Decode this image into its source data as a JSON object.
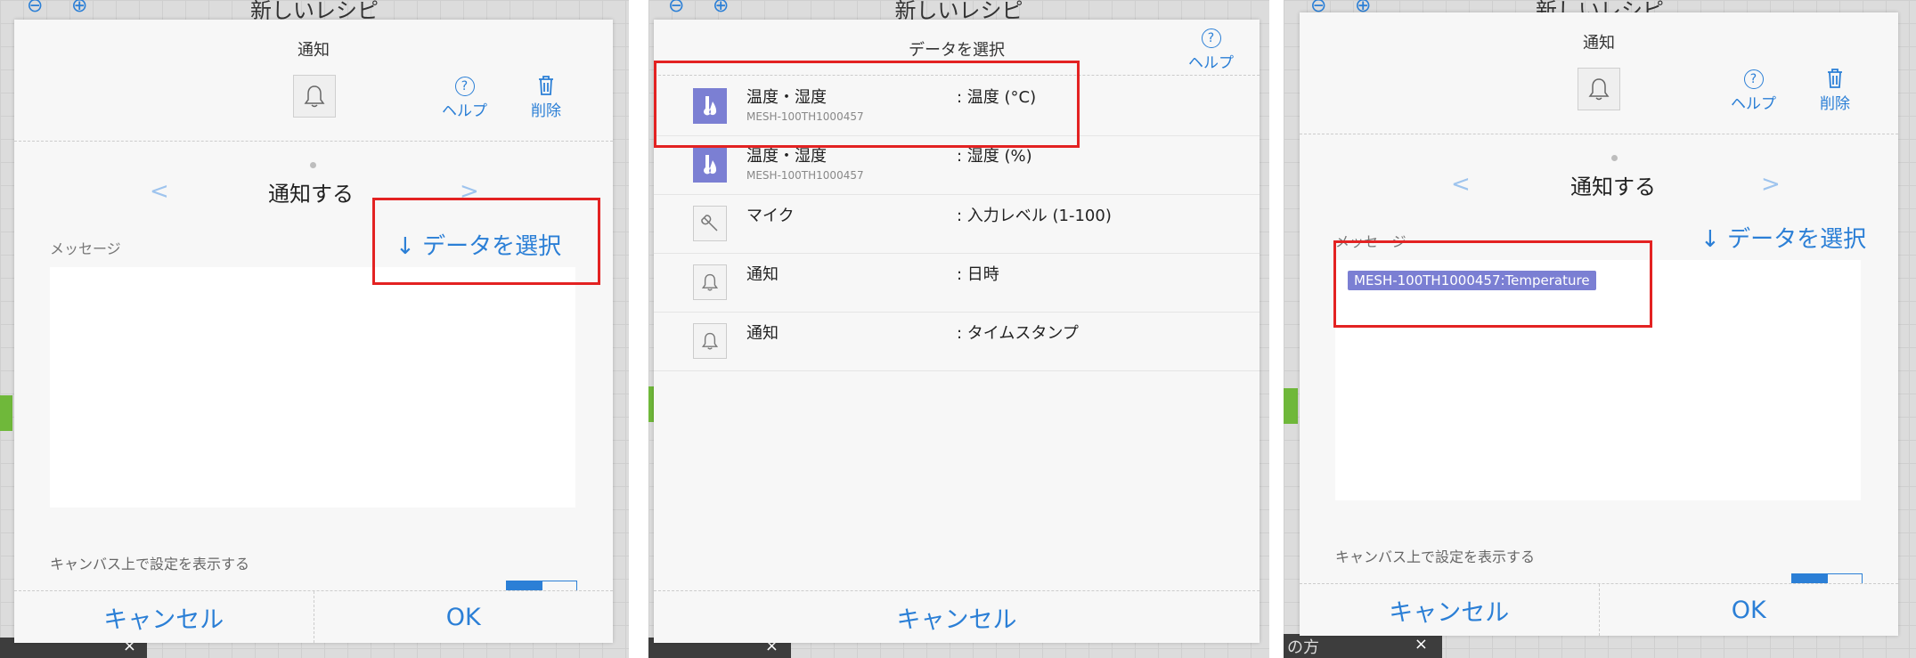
{
  "app": {
    "title": "新しいレシピ"
  },
  "panel1": {
    "dialog_title": "通知",
    "help_label": "ヘルプ",
    "delete_label": "削除",
    "notify_title": "通知する",
    "message_label": "メッセージ",
    "select_data_label": "データを選択",
    "show_on_canvas_label": "キャンバス上で設定を表示する",
    "cancel_label": "キャンセル",
    "ok_label": "OK"
  },
  "panel2": {
    "dialog_title": "データを選択",
    "help_label": "ヘルプ",
    "cancel_label": "キャンセル",
    "items": [
      {
        "name": "温度・湿度",
        "sub": "MESH-100TH1000457",
        "value": ": 温度 (°C)",
        "icon": "thermometer-icon"
      },
      {
        "name": "温度・湿度",
        "sub": "MESH-100TH1000457",
        "value": ": 湿度 (%)",
        "icon": "thermometer-icon"
      },
      {
        "name": "マイク",
        "sub": "",
        "value": ": 入力レベル (1-100)",
        "icon": "microphone-icon"
      },
      {
        "name": "通知",
        "sub": "",
        "value": ": 日時",
        "icon": "bell-icon"
      },
      {
        "name": "通知",
        "sub": "",
        "value": ": タイムスタンプ",
        "icon": "bell-icon"
      }
    ]
  },
  "panel3": {
    "dialog_title": "通知",
    "help_label": "ヘルプ",
    "delete_label": "削除",
    "notify_title": "通知する",
    "message_label": "メッセージ",
    "select_data_label": "データを選択",
    "message_tag": "MESH-100TH1000457:Temperature",
    "show_on_canvas_label": "キャンバス上で設定を表示する",
    "cancel_label": "キャンセル",
    "ok_label": "OK"
  },
  "background": {
    "tab_fragment": "の方"
  },
  "colors": {
    "accent": "#2b7fd6",
    "highlight": "#e32222",
    "tag": "#7b7fd3"
  }
}
